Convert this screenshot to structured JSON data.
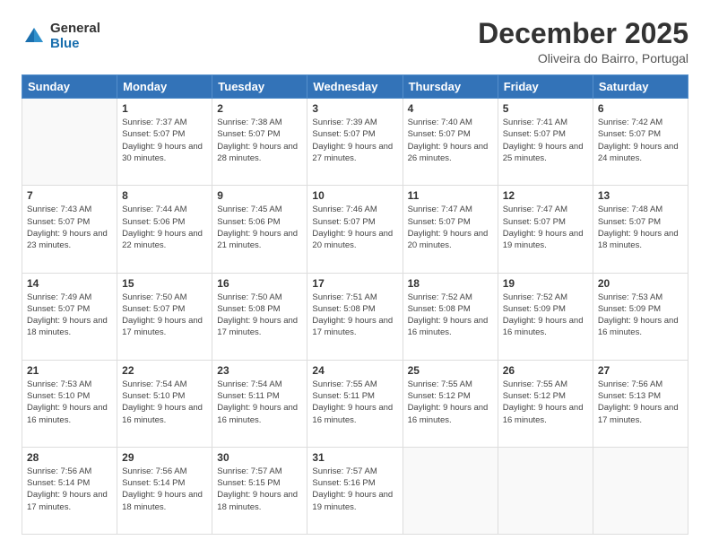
{
  "logo": {
    "general": "General",
    "blue": "Blue"
  },
  "header": {
    "month": "December 2025",
    "location": "Oliveira do Bairro, Portugal"
  },
  "weekdays": [
    "Sunday",
    "Monday",
    "Tuesday",
    "Wednesday",
    "Thursday",
    "Friday",
    "Saturday"
  ],
  "weeks": [
    [
      {
        "day": "",
        "empty": true
      },
      {
        "day": "1",
        "sunrise": "Sunrise: 7:37 AM",
        "sunset": "Sunset: 5:07 PM",
        "daylight": "Daylight: 9 hours and 30 minutes."
      },
      {
        "day": "2",
        "sunrise": "Sunrise: 7:38 AM",
        "sunset": "Sunset: 5:07 PM",
        "daylight": "Daylight: 9 hours and 28 minutes."
      },
      {
        "day": "3",
        "sunrise": "Sunrise: 7:39 AM",
        "sunset": "Sunset: 5:07 PM",
        "daylight": "Daylight: 9 hours and 27 minutes."
      },
      {
        "day": "4",
        "sunrise": "Sunrise: 7:40 AM",
        "sunset": "Sunset: 5:07 PM",
        "daylight": "Daylight: 9 hours and 26 minutes."
      },
      {
        "day": "5",
        "sunrise": "Sunrise: 7:41 AM",
        "sunset": "Sunset: 5:07 PM",
        "daylight": "Daylight: 9 hours and 25 minutes."
      },
      {
        "day": "6",
        "sunrise": "Sunrise: 7:42 AM",
        "sunset": "Sunset: 5:07 PM",
        "daylight": "Daylight: 9 hours and 24 minutes."
      }
    ],
    [
      {
        "day": "7",
        "sunrise": "Sunrise: 7:43 AM",
        "sunset": "Sunset: 5:07 PM",
        "daylight": "Daylight: 9 hours and 23 minutes."
      },
      {
        "day": "8",
        "sunrise": "Sunrise: 7:44 AM",
        "sunset": "Sunset: 5:06 PM",
        "daylight": "Daylight: 9 hours and 22 minutes."
      },
      {
        "day": "9",
        "sunrise": "Sunrise: 7:45 AM",
        "sunset": "Sunset: 5:06 PM",
        "daylight": "Daylight: 9 hours and 21 minutes."
      },
      {
        "day": "10",
        "sunrise": "Sunrise: 7:46 AM",
        "sunset": "Sunset: 5:07 PM",
        "daylight": "Daylight: 9 hours and 20 minutes."
      },
      {
        "day": "11",
        "sunrise": "Sunrise: 7:47 AM",
        "sunset": "Sunset: 5:07 PM",
        "daylight": "Daylight: 9 hours and 20 minutes."
      },
      {
        "day": "12",
        "sunrise": "Sunrise: 7:47 AM",
        "sunset": "Sunset: 5:07 PM",
        "daylight": "Daylight: 9 hours and 19 minutes."
      },
      {
        "day": "13",
        "sunrise": "Sunrise: 7:48 AM",
        "sunset": "Sunset: 5:07 PM",
        "daylight": "Daylight: 9 hours and 18 minutes."
      }
    ],
    [
      {
        "day": "14",
        "sunrise": "Sunrise: 7:49 AM",
        "sunset": "Sunset: 5:07 PM",
        "daylight": "Daylight: 9 hours and 18 minutes."
      },
      {
        "day": "15",
        "sunrise": "Sunrise: 7:50 AM",
        "sunset": "Sunset: 5:07 PM",
        "daylight": "Daylight: 9 hours and 17 minutes."
      },
      {
        "day": "16",
        "sunrise": "Sunrise: 7:50 AM",
        "sunset": "Sunset: 5:08 PM",
        "daylight": "Daylight: 9 hours and 17 minutes."
      },
      {
        "day": "17",
        "sunrise": "Sunrise: 7:51 AM",
        "sunset": "Sunset: 5:08 PM",
        "daylight": "Daylight: 9 hours and 17 minutes."
      },
      {
        "day": "18",
        "sunrise": "Sunrise: 7:52 AM",
        "sunset": "Sunset: 5:08 PM",
        "daylight": "Daylight: 9 hours and 16 minutes."
      },
      {
        "day": "19",
        "sunrise": "Sunrise: 7:52 AM",
        "sunset": "Sunset: 5:09 PM",
        "daylight": "Daylight: 9 hours and 16 minutes."
      },
      {
        "day": "20",
        "sunrise": "Sunrise: 7:53 AM",
        "sunset": "Sunset: 5:09 PM",
        "daylight": "Daylight: 9 hours and 16 minutes."
      }
    ],
    [
      {
        "day": "21",
        "sunrise": "Sunrise: 7:53 AM",
        "sunset": "Sunset: 5:10 PM",
        "daylight": "Daylight: 9 hours and 16 minutes."
      },
      {
        "day": "22",
        "sunrise": "Sunrise: 7:54 AM",
        "sunset": "Sunset: 5:10 PM",
        "daylight": "Daylight: 9 hours and 16 minutes."
      },
      {
        "day": "23",
        "sunrise": "Sunrise: 7:54 AM",
        "sunset": "Sunset: 5:11 PM",
        "daylight": "Daylight: 9 hours and 16 minutes."
      },
      {
        "day": "24",
        "sunrise": "Sunrise: 7:55 AM",
        "sunset": "Sunset: 5:11 PM",
        "daylight": "Daylight: 9 hours and 16 minutes."
      },
      {
        "day": "25",
        "sunrise": "Sunrise: 7:55 AM",
        "sunset": "Sunset: 5:12 PM",
        "daylight": "Daylight: 9 hours and 16 minutes."
      },
      {
        "day": "26",
        "sunrise": "Sunrise: 7:55 AM",
        "sunset": "Sunset: 5:12 PM",
        "daylight": "Daylight: 9 hours and 16 minutes."
      },
      {
        "day": "27",
        "sunrise": "Sunrise: 7:56 AM",
        "sunset": "Sunset: 5:13 PM",
        "daylight": "Daylight: 9 hours and 17 minutes."
      }
    ],
    [
      {
        "day": "28",
        "sunrise": "Sunrise: 7:56 AM",
        "sunset": "Sunset: 5:14 PM",
        "daylight": "Daylight: 9 hours and 17 minutes."
      },
      {
        "day": "29",
        "sunrise": "Sunrise: 7:56 AM",
        "sunset": "Sunset: 5:14 PM",
        "daylight": "Daylight: 9 hours and 18 minutes."
      },
      {
        "day": "30",
        "sunrise": "Sunrise: 7:57 AM",
        "sunset": "Sunset: 5:15 PM",
        "daylight": "Daylight: 9 hours and 18 minutes."
      },
      {
        "day": "31",
        "sunrise": "Sunrise: 7:57 AM",
        "sunset": "Sunset: 5:16 PM",
        "daylight": "Daylight: 9 hours and 19 minutes."
      },
      {
        "day": "",
        "empty": true
      },
      {
        "day": "",
        "empty": true
      },
      {
        "day": "",
        "empty": true
      }
    ]
  ]
}
